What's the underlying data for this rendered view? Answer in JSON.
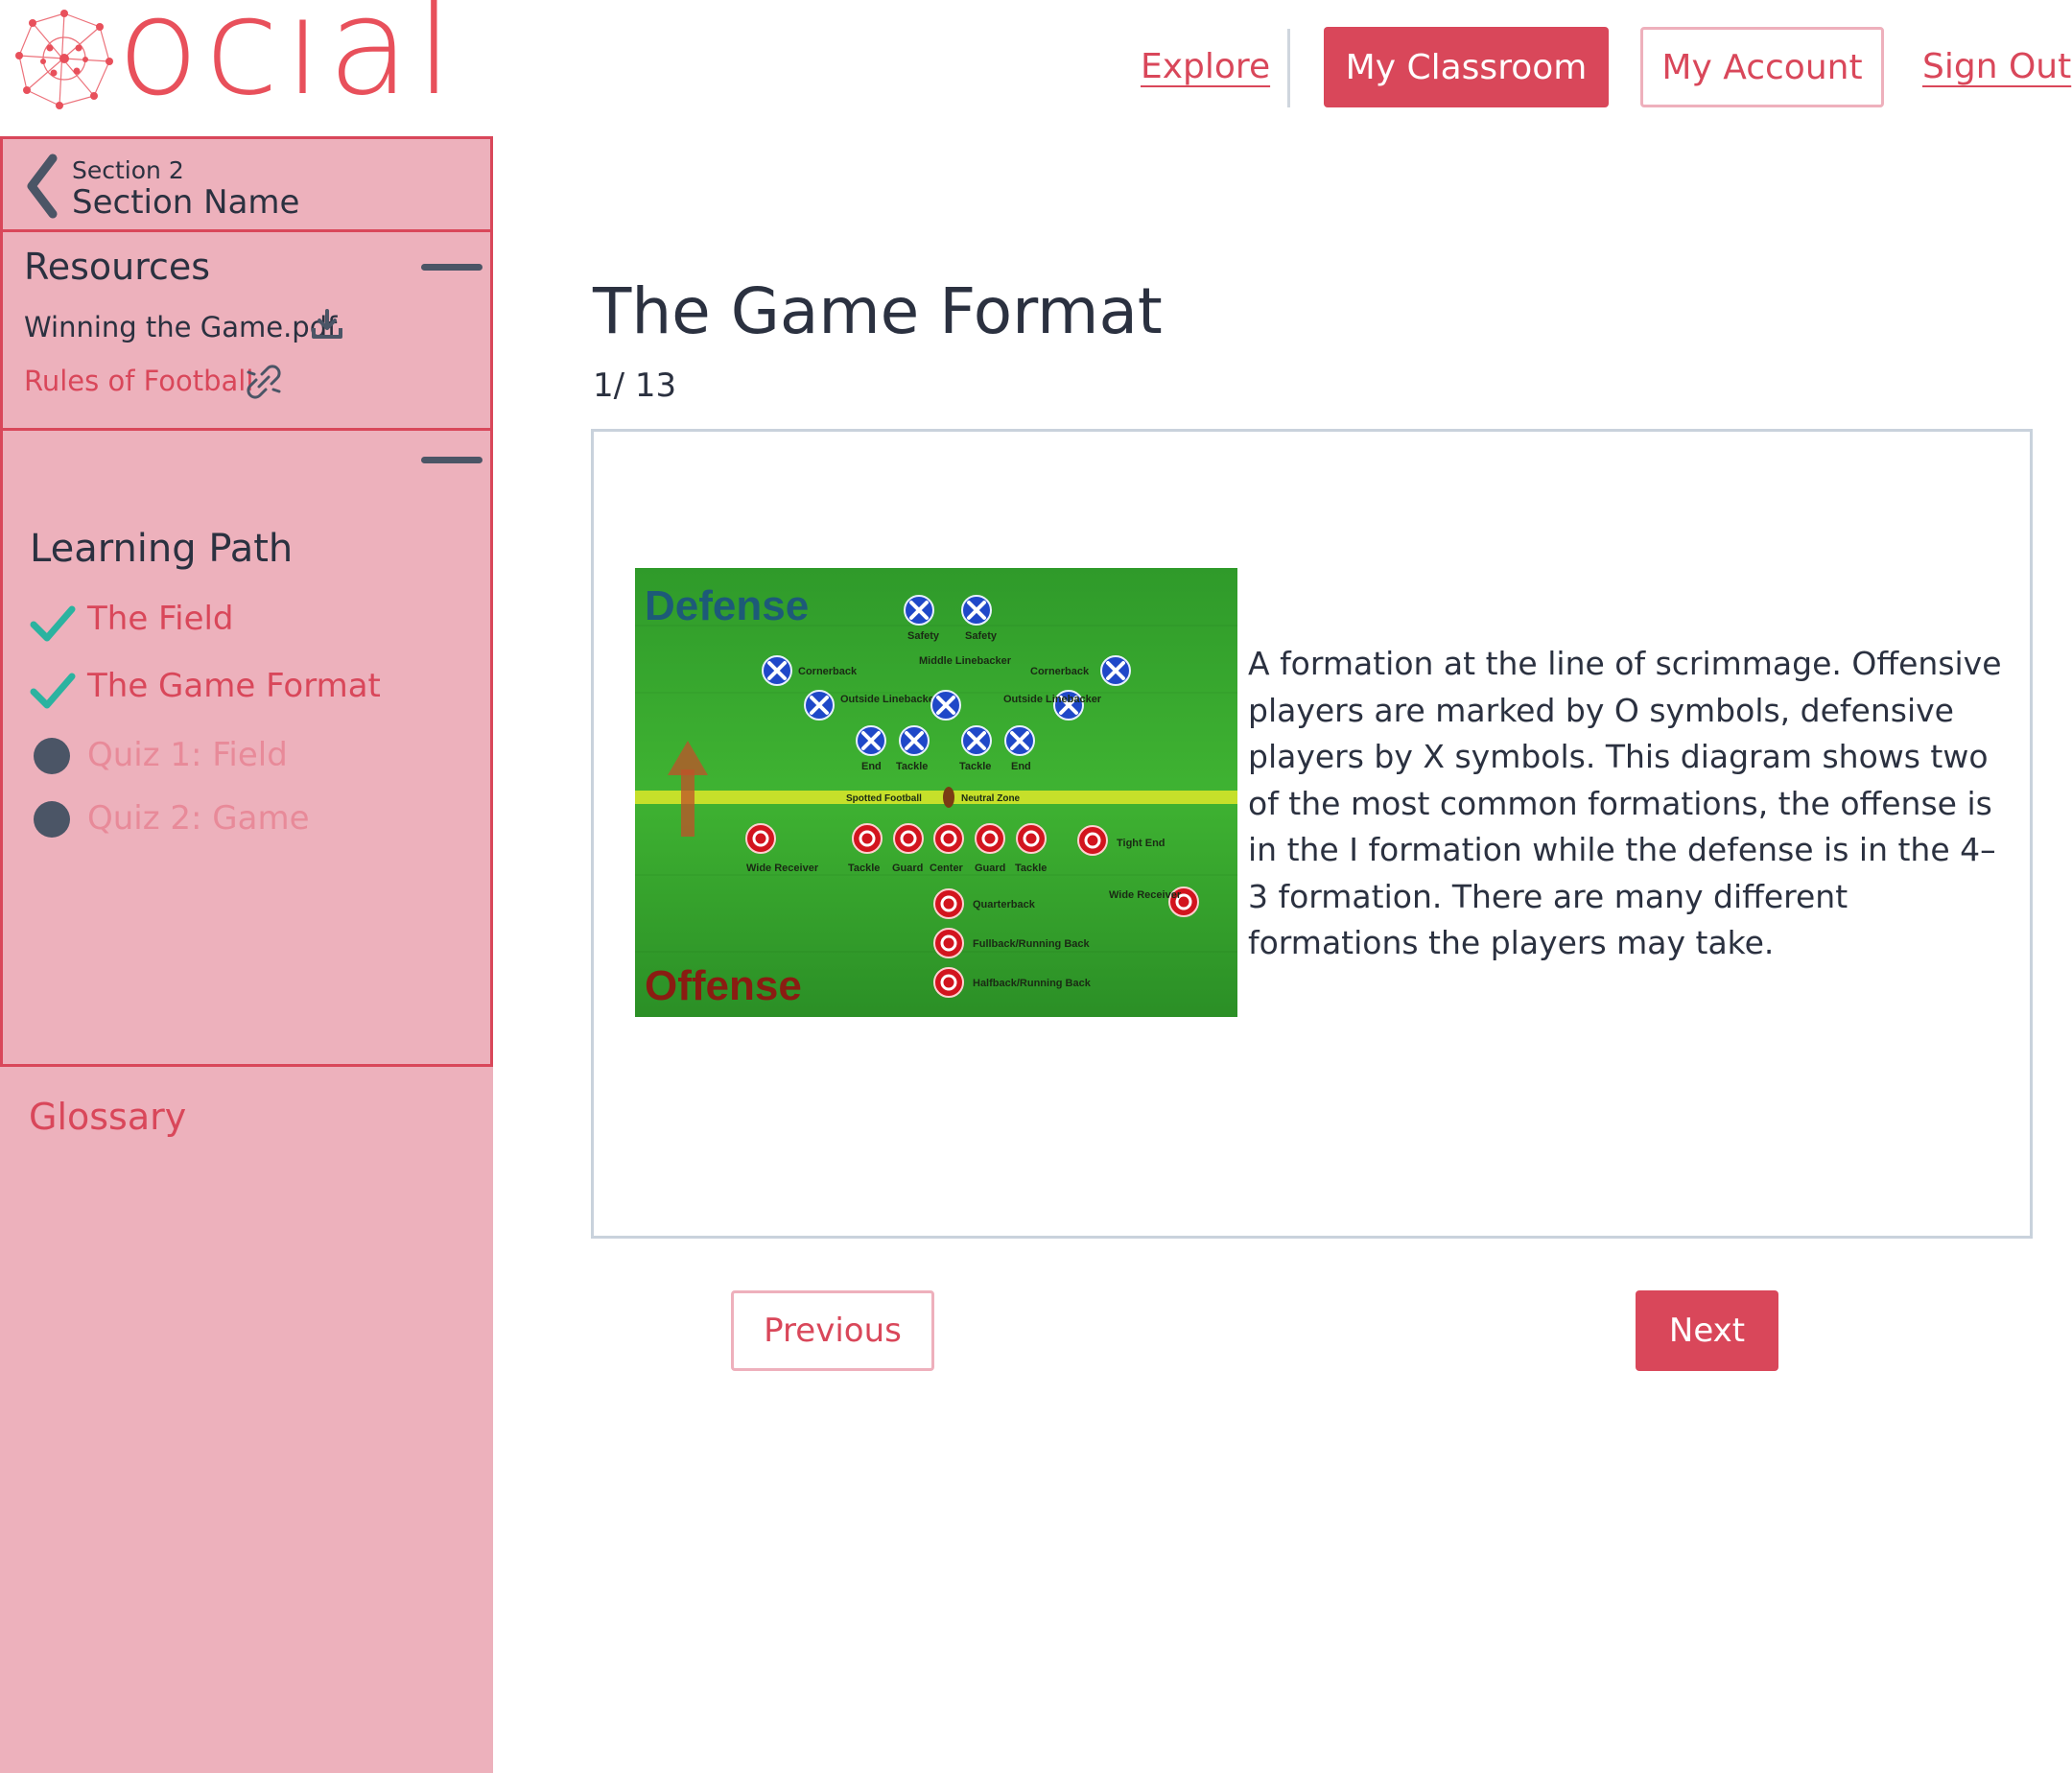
{
  "brand": {
    "name": "ocial",
    "accent": "#d9475a",
    "sidebar_bg": "#edb1bc"
  },
  "nav": {
    "explore": "Explore",
    "my_classroom": "My Classroom",
    "my_account": "My Account",
    "sign_out": "Sign Out"
  },
  "sidebar": {
    "section_number": "Section 2",
    "section_name": "Section Name",
    "resources": {
      "title": "Resources",
      "items": [
        {
          "label": "Winning the Game.pdf",
          "icon": "download-icon"
        },
        {
          "label": "Rules of Football",
          "icon": "external-link-icon"
        }
      ]
    },
    "learning_path": {
      "title": "Learning Path",
      "items": [
        {
          "label": "The Field",
          "status": "complete"
        },
        {
          "label": "The Game Format",
          "status": "complete"
        },
        {
          "label": "Quiz 1: Field",
          "status": "incomplete"
        },
        {
          "label": "Quiz 2: Game",
          "status": "incomplete"
        }
      ]
    },
    "glossary": "Glossary"
  },
  "main": {
    "title": "The Game Format",
    "page_counter": "1/ 13",
    "description": "A formation at the line of scrimmage. Offensive players are marked by O symbols, defensive players by X symbols. This diagram shows two of the most common formations, the offense is in the I formation while the defense is in the 4–3 formation. There are many different formations the players may take.",
    "figure": {
      "defense_label": "Defense",
      "offense_label": "Offense",
      "defense_players": [
        "Safety",
        "Safety",
        "Cornerback",
        "Middle Linebacker",
        "Cornerback",
        "Outside Linebacker",
        "Outside Linebacker",
        "End",
        "Tackle",
        "Tackle",
        "End"
      ],
      "line_labels": {
        "spotted": "Spotted Football",
        "neutral": "Neutral Zone"
      },
      "offense_players": [
        "Wide Receiver",
        "Tackle",
        "Guard",
        "Center",
        "Guard",
        "Tackle",
        "Tight End",
        "Wide Receiver",
        "Quarterback",
        "Fullback/Running Back",
        "Halfback/Running Back"
      ]
    },
    "previous": "Previous",
    "next": "Next"
  }
}
